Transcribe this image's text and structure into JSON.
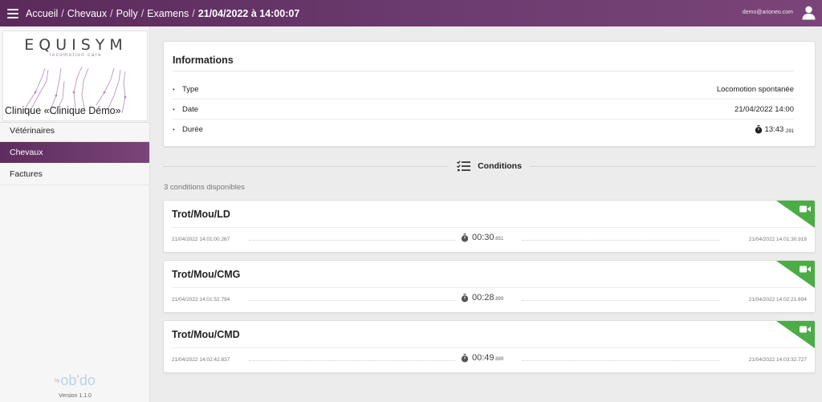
{
  "topbar": {
    "breadcrumb": [
      "Accueil",
      "Chevaux",
      "Polly",
      "Examens"
    ],
    "current": "21/04/2022 à 14:00:07",
    "separator": "/",
    "user_email": "demo@arioneo.com"
  },
  "sidebar": {
    "logo_title": "EQUISYM",
    "logo_subtitle": "locomotion care",
    "clinic": "Clinique «Clinique Démo»",
    "items": [
      {
        "label": "Vétérinaires",
        "active": false
      },
      {
        "label": "Chevaux",
        "active": true
      },
      {
        "label": "Factures",
        "active": false
      }
    ],
    "powered_by_prefix": "by",
    "powered_by": "ob'do",
    "version": "Version 1.1.0"
  },
  "info": {
    "title": "Informations",
    "rows": [
      {
        "label": "Type",
        "value": "Locomotion spontanée"
      },
      {
        "label": "Date",
        "value": "21/04/2022 14:00"
      },
      {
        "label": "Durée",
        "value": "13:43",
        "ms": ".291",
        "icon": "stopwatch-icon"
      }
    ]
  },
  "conditions": {
    "title": "Conditions",
    "count_text": "3 conditions disponibles",
    "items": [
      {
        "name": "Trot/Mou/LD",
        "start": "21/04/2022 14:01:00.267",
        "duration": "00:30",
        "ms": ".651",
        "end": "21/04/2022 14:01:30.919"
      },
      {
        "name": "Trot/Mou/CMG",
        "start": "21/04/2022 14:01:52.794",
        "duration": "00:28",
        "ms": ".899",
        "end": "21/04/2022 14:02:21.694"
      },
      {
        "name": "Trot/Mou/CMD",
        "start": "21/04/2022 14:02:42.837",
        "duration": "00:49",
        "ms": ".889",
        "end": "21/04/2022 14:03:32.727"
      }
    ]
  },
  "colors": {
    "brand": "#6b3a6e",
    "video_badge": "#4cac47",
    "background": "#ececec"
  }
}
